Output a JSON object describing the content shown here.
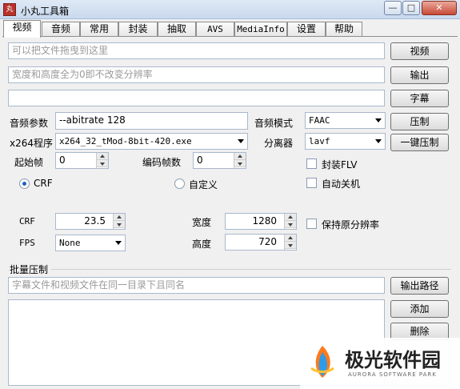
{
  "window": {
    "title": "小丸工具箱",
    "icon": "app-icon"
  },
  "tabs": [
    {
      "label": "视频",
      "active": true
    },
    {
      "label": "音频"
    },
    {
      "label": "常用"
    },
    {
      "label": "封装"
    },
    {
      "label": "抽取"
    },
    {
      "label": "AVS"
    },
    {
      "label": "MediaInfo"
    },
    {
      "label": "设置"
    },
    {
      "label": "帮助"
    }
  ],
  "video": {
    "drop_placeholder": "可以把文件拖曳到这里",
    "size_placeholder": "宽度和高度全为0即不改变分辨率",
    "subtitle_value": "",
    "buttons": {
      "video": "视频",
      "output": "输出",
      "subtitle": "字幕",
      "compress": "压制",
      "one_click": "一键压制"
    },
    "audio_params_label": "音频参数",
    "audio_params_value": "--abitrate 128",
    "audio_mode_label": "音频模式",
    "audio_mode_value": "FAAC",
    "x264_label": "x264程序",
    "x264_value": "x264_32_tMod-8bit-420.exe",
    "splitter_label": "分离器",
    "splitter_value": "lavf",
    "start_frame_label": "起始帧",
    "start_frame_value": "0",
    "encode_frames_label": "编码帧数",
    "encode_frames_value": "0",
    "mux_flv_label": "封装FLV",
    "auto_shutdown_label": "自动关机",
    "crf_radio_label": "CRF",
    "custom_radio_label": "自定义",
    "crf_label": "CRF",
    "crf_value": "23.5",
    "fps_label": "FPS",
    "fps_value": "None",
    "width_label": "宽度",
    "width_value": "1280",
    "height_label": "高度",
    "height_value": "720",
    "keep_res_label": "保持原分辨率"
  },
  "batch": {
    "title": "批量压制",
    "hint_placeholder": "字幕文件和视频文件在同一目录下且同名",
    "buttons": {
      "output_path": "输出路径",
      "add": "添加",
      "delete": "删除"
    }
  },
  "watermark": {
    "text": "极光软件园",
    "sub": "AURORA SOFTWARE PARK"
  }
}
